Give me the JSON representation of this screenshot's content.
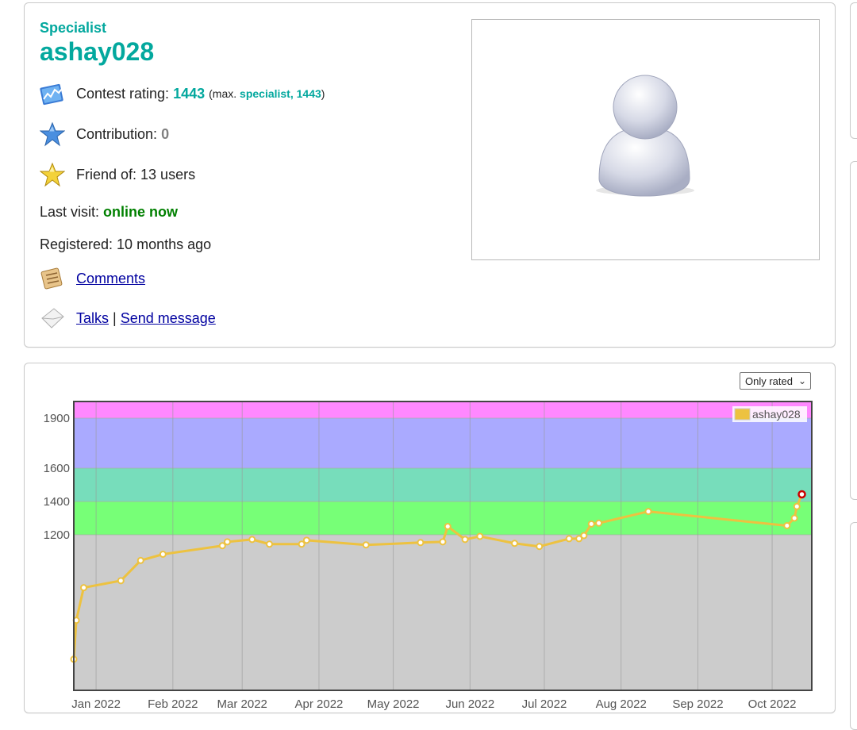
{
  "profile": {
    "rank": "Specialist",
    "handle": "ashay028",
    "contest_rating_label": "Contest rating:",
    "contest_rating_value": "1443",
    "max_prefix": "(max.",
    "max_rank_rating": "specialist, 1443",
    "max_suffix": ")",
    "contribution_label": "Contribution:",
    "contribution_value": "0",
    "friend_of": "Friend of: 13 users",
    "last_visit_label": "Last visit:",
    "last_visit_value": "online now",
    "registered": "Registered: 10 months ago",
    "comments_link": "Comments",
    "talks_link": "Talks",
    "separator": "|",
    "send_message_link": "Send message"
  },
  "graph": {
    "filter_select": "Only rated",
    "legend": "ashay028"
  },
  "colors": {
    "handle": "#03a89e",
    "online": "#008000",
    "line": "#edc240",
    "band_newbie": "#cccccc",
    "band_pupil": "#77ff77",
    "band_specialist": "#77ddbb",
    "band_expert": "#aaaaff",
    "band_cm": "#ff88ff"
  },
  "chart_data": {
    "type": "line",
    "series_name": "ashay028",
    "x_ticks": [
      "Jan 2022",
      "Feb 2022",
      "Mar 2022",
      "Apr 2022",
      "May 2022",
      "Jun 2022",
      "Jul 2022",
      "Aug 2022",
      "Sep 2022",
      "Oct 2022"
    ],
    "y_ticks": [
      1200,
      1400,
      1600,
      1900
    ],
    "ylim": [
      200,
      2000
    ],
    "xlim": [
      "2021-12-23",
      "2022-10-17"
    ],
    "bands": [
      {
        "from": 0,
        "to": 1200,
        "color": "#cccccc"
      },
      {
        "from": 1200,
        "to": 1400,
        "color": "#77ff77"
      },
      {
        "from": 1400,
        "to": 1600,
        "color": "#77ddbb"
      },
      {
        "from": 1600,
        "to": 1900,
        "color": "#aaaaff"
      },
      {
        "from": 1900,
        "to": 2100,
        "color": "#ff88ff"
      }
    ],
    "points": [
      {
        "date": "2021-12-23",
        "rating": 400
      },
      {
        "date": "2021-12-24",
        "rating": 650
      },
      {
        "date": "2021-12-27",
        "rating": 860
      },
      {
        "date": "2022-01-11",
        "rating": 905
      },
      {
        "date": "2022-01-19",
        "rating": 1035
      },
      {
        "date": "2022-01-28",
        "rating": 1075
      },
      {
        "date": "2022-02-21",
        "rating": 1130
      },
      {
        "date": "2022-02-23",
        "rating": 1155
      },
      {
        "date": "2022-03-05",
        "rating": 1170
      },
      {
        "date": "2022-03-12",
        "rating": 1140
      },
      {
        "date": "2022-03-25",
        "rating": 1140
      },
      {
        "date": "2022-03-27",
        "rating": 1165
      },
      {
        "date": "2022-04-20",
        "rating": 1135
      },
      {
        "date": "2022-05-12",
        "rating": 1150
      },
      {
        "date": "2022-05-21",
        "rating": 1155
      },
      {
        "date": "2022-05-23",
        "rating": 1250
      },
      {
        "date": "2022-05-30",
        "rating": 1170
      },
      {
        "date": "2022-06-05",
        "rating": 1190
      },
      {
        "date": "2022-06-19",
        "rating": 1145
      },
      {
        "date": "2022-06-29",
        "rating": 1125
      },
      {
        "date": "2022-07-11",
        "rating": 1175
      },
      {
        "date": "2022-07-15",
        "rating": 1175
      },
      {
        "date": "2022-07-17",
        "rating": 1195
      },
      {
        "date": "2022-07-20",
        "rating": 1265
      },
      {
        "date": "2022-07-23",
        "rating": 1270
      },
      {
        "date": "2022-08-12",
        "rating": 1340
      },
      {
        "date": "2022-10-07",
        "rating": 1255
      },
      {
        "date": "2022-10-10",
        "rating": 1300
      },
      {
        "date": "2022-10-11",
        "rating": 1370
      },
      {
        "date": "2022-10-13",
        "rating": 1443
      }
    ]
  }
}
